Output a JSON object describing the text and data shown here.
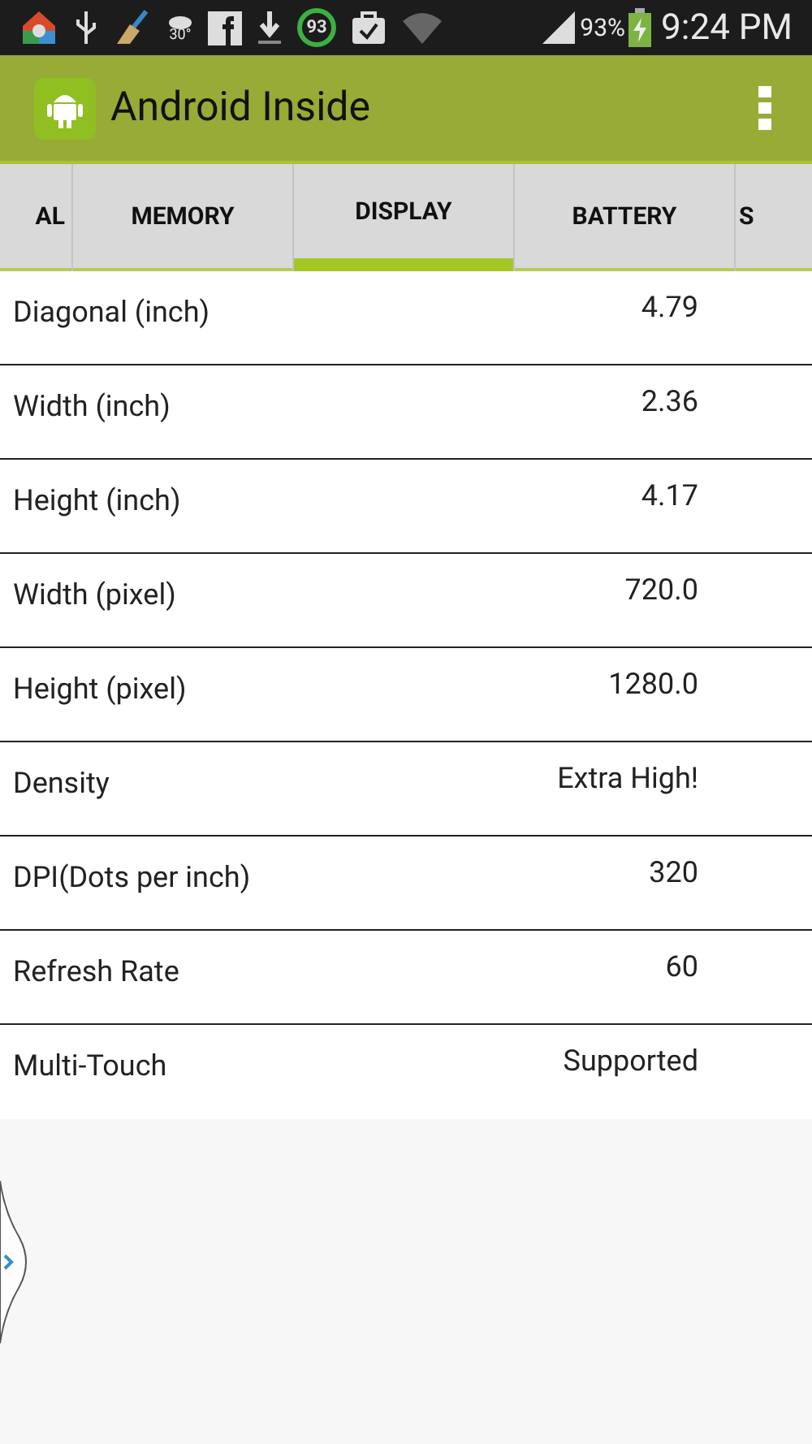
{
  "status_bar": {
    "weather": "30°",
    "cleaner_badge": "93",
    "battery": "93%",
    "time": "9:24 PM"
  },
  "app_bar": {
    "title": "Android Inside"
  },
  "tabs": [
    {
      "label": "AL",
      "selected": false
    },
    {
      "label": "MEMORY",
      "selected": false
    },
    {
      "label": "DISPLAY",
      "selected": true
    },
    {
      "label": "BATTERY",
      "selected": false
    },
    {
      "label": "S",
      "selected": false
    }
  ],
  "rows": [
    {
      "label": "Diagonal (inch)",
      "value": "4.79"
    },
    {
      "label": "Width (inch)",
      "value": "2.36"
    },
    {
      "label": "Height (inch)",
      "value": "4.17"
    },
    {
      "label": "Width (pixel)",
      "value": "720.0"
    },
    {
      "label": "Height (pixel)",
      "value": "1280.0"
    },
    {
      "label": "Density",
      "value": "Extra High!"
    },
    {
      "label": "DPI(Dots per inch)",
      "value": "320"
    },
    {
      "label": "Refresh Rate",
      "value": "60"
    },
    {
      "label": "Multi-Touch",
      "value": "Supported"
    }
  ]
}
